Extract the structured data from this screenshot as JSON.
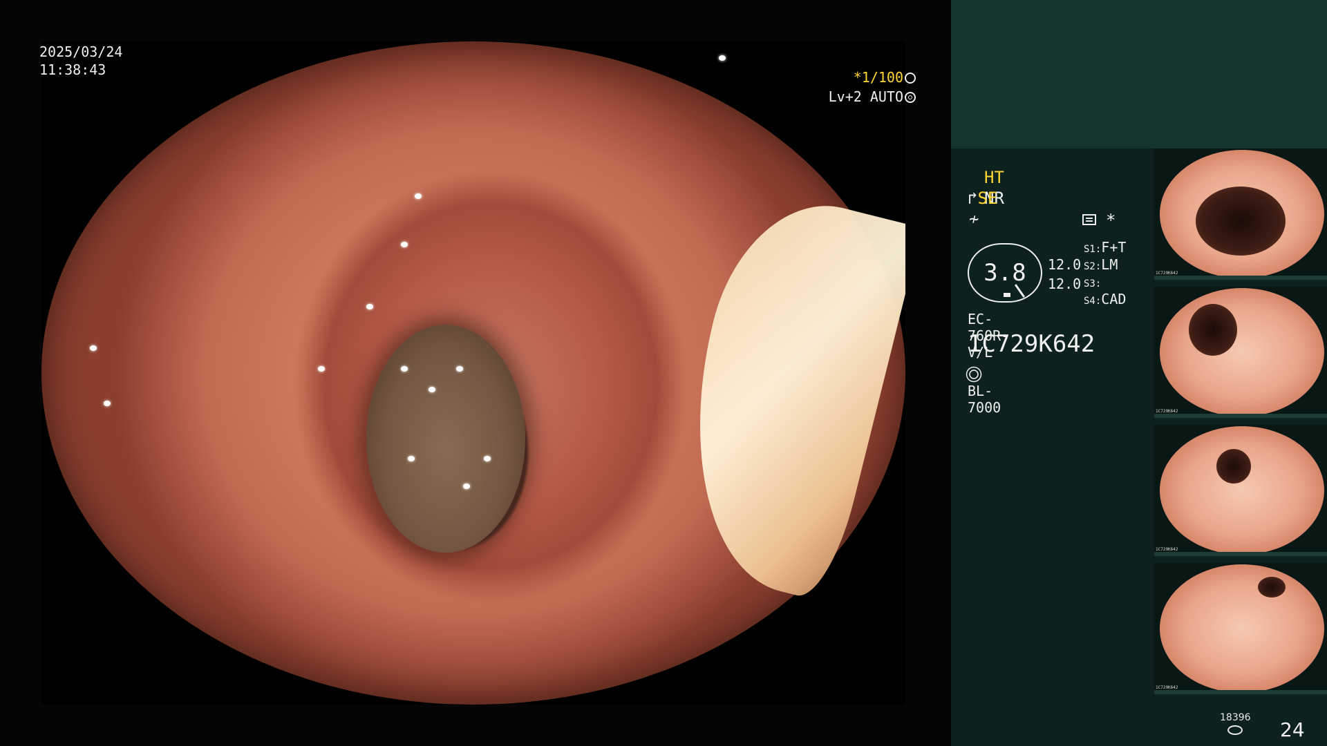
{
  "datetime": {
    "date": "2025/03/24",
    "time": "11:38:43"
  },
  "shutter": {
    "speed": "*1/100",
    "level": "Lv+2",
    "mode": "AUTO"
  },
  "modes": {
    "ht": "HT",
    "nr": "NR",
    "se": "SE"
  },
  "gauge": {
    "value": "3.8"
  },
  "pairs": [
    "12.0",
    "12.0"
  ],
  "presets": [
    {
      "key": "S1",
      "value": "F+T"
    },
    {
      "key": "S2",
      "value": "LM"
    },
    {
      "key": "S3",
      "value": ""
    },
    {
      "key": "S4",
      "value": "CAD"
    }
  ],
  "scope": {
    "model": "EC-760R-V/L",
    "serial": "1C729K642",
    "light_source": "BL-7000"
  },
  "thumbnails": [
    {
      "label": "1C729K642"
    },
    {
      "label": "1C729K642"
    },
    {
      "label": "1C729K642"
    },
    {
      "label": "1C729K642"
    }
  ],
  "footer": {
    "storage_count": "18396",
    "image_count": "24"
  },
  "colors": {
    "accent_yellow": "#ffd633",
    "panel_top": "#143530",
    "panel_body": "#0d211e"
  }
}
